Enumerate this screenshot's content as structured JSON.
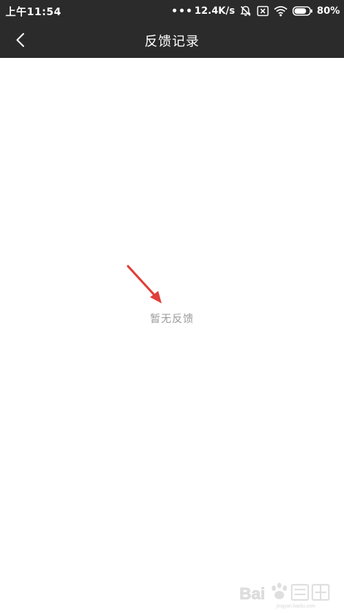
{
  "status_bar": {
    "time": "上午11:54",
    "net_dots": "•••",
    "net_speed": "12.4K/s",
    "battery_text": "80%",
    "battery_level": 0.8,
    "icons": [
      "mute-bell-icon",
      "sim-blocked-icon",
      "wifi-icon",
      "battery-icon"
    ]
  },
  "header": {
    "back_icon": "chevron-left-icon",
    "title": "反馈记录"
  },
  "main": {
    "empty_text": "暂无反馈"
  },
  "annotation": {
    "color": "#e0403a"
  },
  "watermark": {
    "brand": "Bai",
    "sub": "jingyan.baidu.com"
  },
  "colors": {
    "bar_bg": "#2b2b2b",
    "empty_text": "#9a9a9a"
  }
}
